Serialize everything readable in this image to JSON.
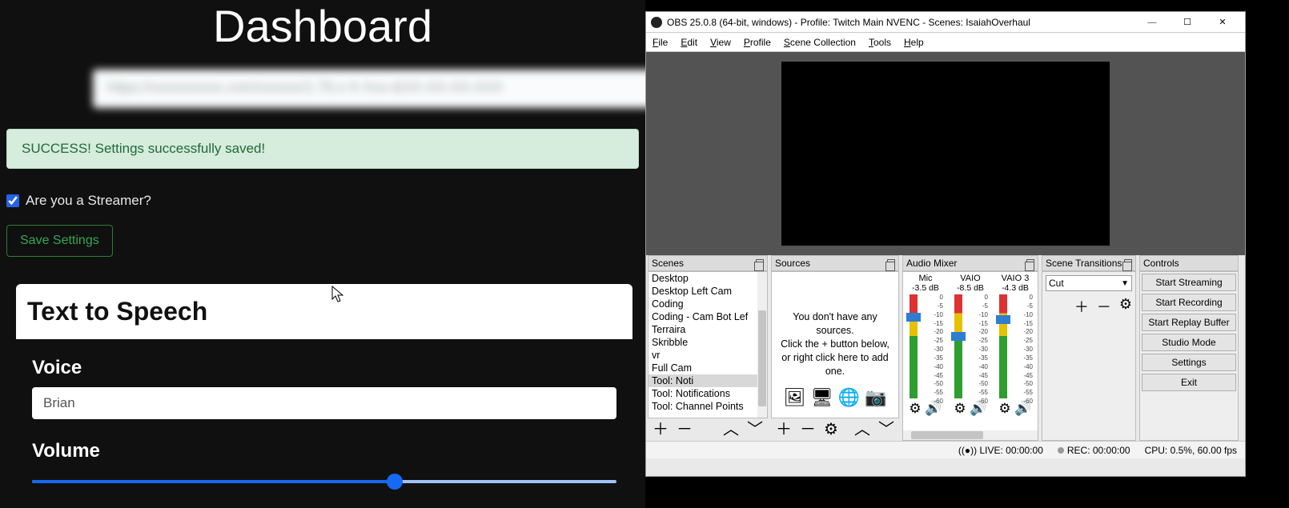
{
  "dashboard": {
    "title": "Dashboard",
    "url_blurred": "https://xxxxxxxxxx.com/xxxxxx/1.79.x-X-Xxx-&XX-XX-XX-XXX",
    "success": "SUCCESS! Settings successfully saved!",
    "streamer_label": "Are you a Streamer?",
    "streamer_checked": true,
    "save_label": "Save Settings",
    "tts_heading": "Text to Speech",
    "voice_label": "Voice",
    "voice_value": "Brian",
    "volume_label": "Volume",
    "volume_percent": 62
  },
  "obs": {
    "title": "OBS 25.0.8 (64-bit, windows) - Profile: Twitch Main NVENC - Scenes: IsaiahOverhaul",
    "menu": [
      "File",
      "Edit",
      "View",
      "Profile",
      "Scene Collection",
      "Tools",
      "Help"
    ],
    "docks": {
      "scenes": {
        "title": "Scenes",
        "items": [
          "Desktop",
          "Desktop Left Cam",
          "Coding",
          "Coding - Cam Bot Lef",
          "Terraira",
          "Skribble",
          "vr",
          "Full Cam",
          "Tool: Noti",
          "Tool: Notifications",
          "Tool: Channel Points"
        ],
        "selected": "Tool: Noti"
      },
      "sources": {
        "title": "Sources",
        "empty1": "You don't have any sources.",
        "empty2": "Click the + button below,",
        "empty3": "or right click here to add one."
      },
      "mixer": {
        "title": "Audio Mixer",
        "channels": [
          {
            "name": "Mic",
            "db": "-3.5 dB",
            "knob_pct": 18
          },
          {
            "name": "VAIO",
            "db": "-8.5 dB",
            "knob_pct": 36
          },
          {
            "name": "VAIO 3",
            "db": "-4.3 dB",
            "knob_pct": 20
          }
        ],
        "tick_labels": [
          "0",
          "-5",
          "-10",
          "-15",
          "-20",
          "-25",
          "-30",
          "-35",
          "-40",
          "-45",
          "-50",
          "-55",
          "-60"
        ]
      },
      "transitions": {
        "title": "Scene Transitions",
        "selected": "Cut"
      },
      "controls": {
        "title": "Controls",
        "buttons": [
          "Start Streaming",
          "Start Recording",
          "Start Replay Buffer",
          "Studio Mode",
          "Settings",
          "Exit"
        ]
      }
    },
    "status": {
      "live": "LIVE: 00:00:00",
      "rec": "REC: 00:00:00",
      "cpu": "CPU: 0.5%, 60.00 fps"
    }
  }
}
